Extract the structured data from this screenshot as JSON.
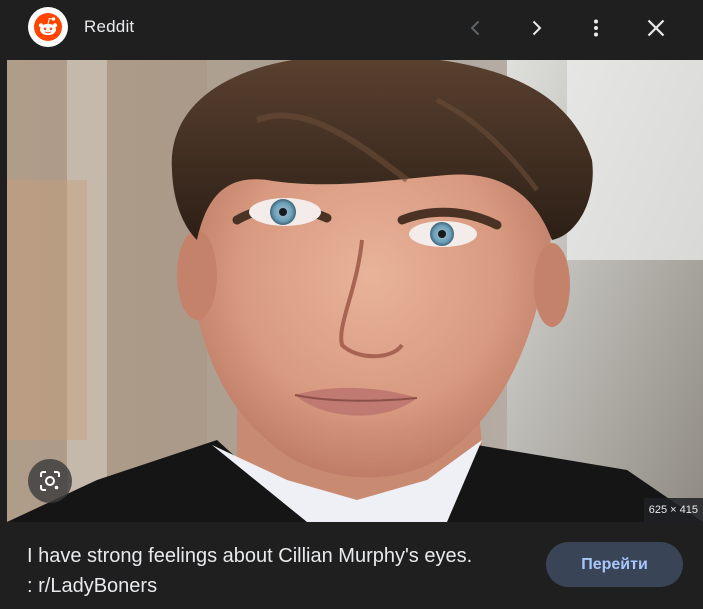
{
  "header": {
    "site_name": "Reddit",
    "logo_icon": "reddit-alien-icon",
    "prev_icon": "chevron-left-icon",
    "next_icon": "chevron-right-icon",
    "more_icon": "more-vert-icon",
    "close_icon": "close-icon"
  },
  "image": {
    "dimensions": "625 × 415",
    "lens_icon": "google-lens-icon"
  },
  "caption": {
    "line1": "I have strong feelings about Cillian Murphy's eyes.",
    "line2": ": r/LadyBoners"
  },
  "actions": {
    "visit_label": "Перейти"
  },
  "colors": {
    "background": "#1f1f1f",
    "reddit_orange": "#ff4500",
    "button_bg": "#394457",
    "button_text": "#a8c7fa"
  }
}
